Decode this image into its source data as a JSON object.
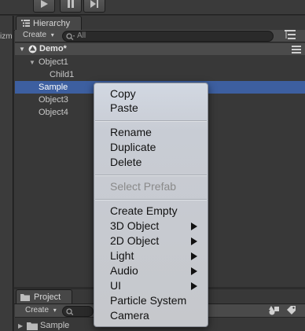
{
  "toolbar": {
    "buttons": [
      "play",
      "pause",
      "step"
    ]
  },
  "left_panel": {
    "tab_fragment": "izm"
  },
  "hierarchy": {
    "tab_label": "Hierarchy",
    "create_label": "Create",
    "search_placeholder": "All",
    "scene_name": "Demo*",
    "items": [
      {
        "label": "Object1",
        "depth": 1,
        "expanded": true
      },
      {
        "label": "Child1",
        "depth": 2
      },
      {
        "label": "Sample",
        "depth": 1,
        "selected": true
      },
      {
        "label": "Object3",
        "depth": 1
      },
      {
        "label": "Object4",
        "depth": 1
      }
    ]
  },
  "context_menu": {
    "groups": [
      [
        "Copy",
        "Paste"
      ],
      [
        "Rename",
        "Duplicate",
        "Delete"
      ],
      [
        "Select Prefab"
      ],
      [
        "Create Empty",
        "3D Object",
        "2D Object",
        "Light",
        "Audio",
        "UI",
        "Particle System",
        "Camera"
      ]
    ],
    "disabled": [
      "Select Prefab"
    ],
    "submenus": [
      "3D Object",
      "2D Object",
      "Light",
      "Audio",
      "UI"
    ]
  },
  "project": {
    "tab_label": "Project",
    "create_label": "Create",
    "folder_label": "Sample"
  },
  "colors": {
    "selection": "#3d5fa0",
    "panel_bg": "#383838",
    "menu_bg": "#c8ccd4"
  }
}
